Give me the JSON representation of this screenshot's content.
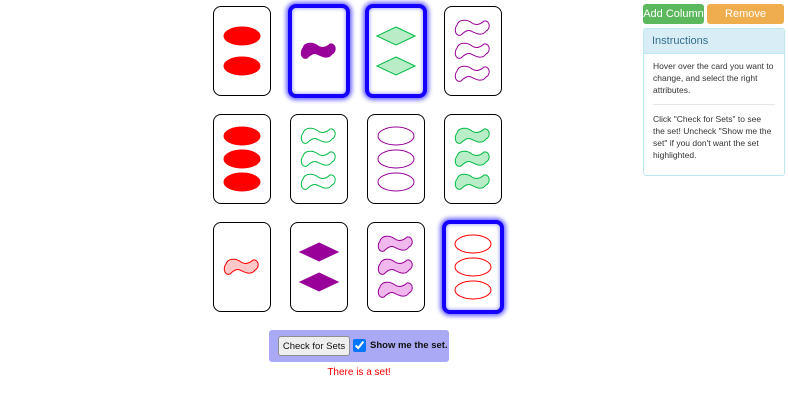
{
  "toolbar": {
    "add_column_label": "Add Column",
    "remove_column_label": "Remove Column"
  },
  "instructions": {
    "title": "Instructions",
    "paragraph1": "Hover over the card you want to change, and select the right attributes.",
    "paragraph2": "Click \"Check for Sets\" to see the set! Uncheck \"Show me the set\" if you don't want the set highlighted."
  },
  "controls": {
    "check_button_label": "Check for Sets",
    "show_set_label": "Show me the set.",
    "show_set_checked": true
  },
  "status_message": "There is a set!",
  "colors": {
    "red": "#ff0000",
    "purple": "#990099",
    "green": "#00bb44",
    "selected_border": "#1400ff",
    "add_button": "#5cb85c",
    "remove_button": "#f0ad4e"
  },
  "cards": [
    {
      "row": 0,
      "col": 0,
      "count": 2,
      "shape": "oval",
      "color": "red",
      "shading": "solid",
      "selected": false
    },
    {
      "row": 0,
      "col": 1,
      "count": 1,
      "shape": "squiggle",
      "color": "purple",
      "shading": "solid",
      "selected": true
    },
    {
      "row": 0,
      "col": 2,
      "count": 2,
      "shape": "diamond",
      "color": "green",
      "shading": "striped",
      "selected": true
    },
    {
      "row": 0,
      "col": 3,
      "count": 3,
      "shape": "squiggle",
      "color": "purple",
      "shading": "open",
      "selected": false
    },
    {
      "row": 1,
      "col": 0,
      "count": 3,
      "shape": "oval",
      "color": "red",
      "shading": "solid",
      "selected": false
    },
    {
      "row": 1,
      "col": 1,
      "count": 3,
      "shape": "squiggle",
      "color": "green",
      "shading": "open",
      "selected": false
    },
    {
      "row": 1,
      "col": 2,
      "count": 3,
      "shape": "oval",
      "color": "purple",
      "shading": "open",
      "selected": false
    },
    {
      "row": 1,
      "col": 3,
      "count": 3,
      "shape": "squiggle",
      "color": "green",
      "shading": "striped",
      "selected": false
    },
    {
      "row": 2,
      "col": 0,
      "count": 1,
      "shape": "squiggle",
      "color": "red",
      "shading": "striped",
      "selected": false
    },
    {
      "row": 2,
      "col": 1,
      "count": 2,
      "shape": "diamond",
      "color": "purple",
      "shading": "solid",
      "selected": false
    },
    {
      "row": 2,
      "col": 2,
      "count": 3,
      "shape": "squiggle",
      "color": "purple",
      "shading": "striped",
      "selected": false
    },
    {
      "row": 2,
      "col": 3,
      "count": 3,
      "shape": "oval",
      "color": "red",
      "shading": "open",
      "selected": true
    }
  ]
}
